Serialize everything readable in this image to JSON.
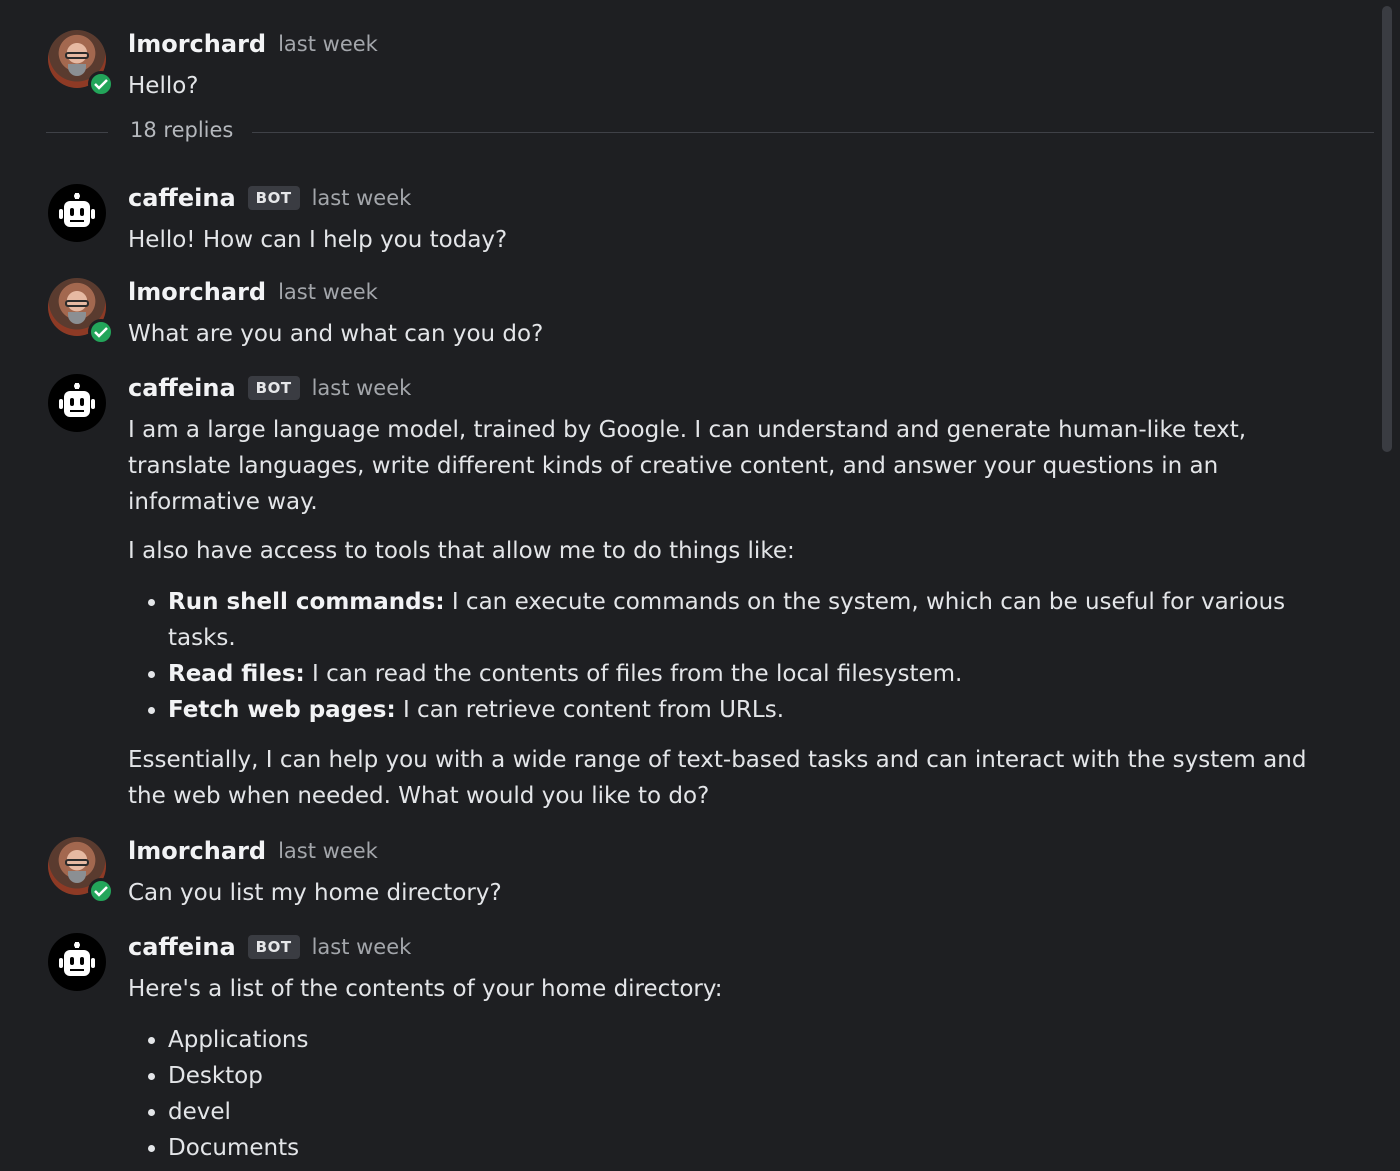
{
  "thread": {
    "root": {
      "author": "lmorchard",
      "time": "last week",
      "text": "Hello?"
    },
    "replies_label": "18 replies",
    "messages": [
      {
        "author": "caffeina",
        "badge": "BOT",
        "time": "last week",
        "text": "Hello! How can I help you today?"
      },
      {
        "author": "lmorchard",
        "time": "last week",
        "text": "What are you and what can you do?"
      },
      {
        "author": "caffeina",
        "badge": "BOT",
        "time": "last week",
        "p1": "I am a large language model, trained by Google. I can understand and generate human-like text, translate languages, write different kinds of creative content, and answer your questions in an informative way.",
        "p2": "I also have access to tools that allow me to do things like:",
        "items": [
          {
            "bold": "Run shell commands:",
            "text": " I can execute commands on the system, which can be useful for various tasks."
          },
          {
            "bold": "Read files:",
            "text": " I can read the contents of files from the local filesystem."
          },
          {
            "bold": "Fetch web pages:",
            "text": " I can retrieve content from URLs."
          }
        ],
        "p3": "Essentially, I can help you with a wide range of text-based tasks and can interact with the system and the web when needed. What would you like to do?"
      },
      {
        "author": "lmorchard",
        "time": "last week",
        "text": "Can you list my home directory?"
      },
      {
        "author": "caffeina",
        "badge": "BOT",
        "time": "last week",
        "intro": "Here's a list of the contents of your home directory:",
        "items": [
          "Applications",
          "Desktop",
          "devel",
          "Documents"
        ]
      }
    ]
  },
  "colors": {
    "background": "#1e1f22",
    "verified": "#23a55a",
    "badge_bg": "#3a3c42"
  }
}
